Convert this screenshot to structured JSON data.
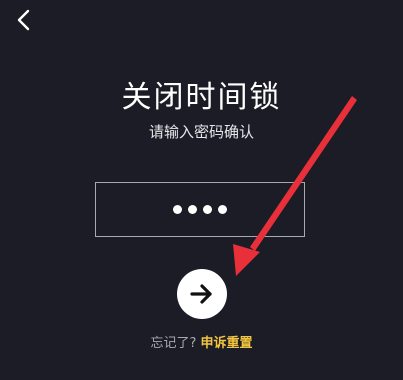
{
  "header": {
    "back_icon": "chevron-left-icon"
  },
  "main": {
    "title": "关闭时间锁",
    "subtitle": "请输入密码确认",
    "password": {
      "masked_length": 4
    },
    "submit_icon": "arrow-right-icon",
    "forgot": {
      "text": "忘记了?",
      "link_label": "申诉重置"
    }
  },
  "annotation": {
    "icon": "red-pointer-arrow"
  },
  "colors": {
    "background": "#1c1c26",
    "accent": "#f2c541",
    "annotation": "#e8303a"
  }
}
